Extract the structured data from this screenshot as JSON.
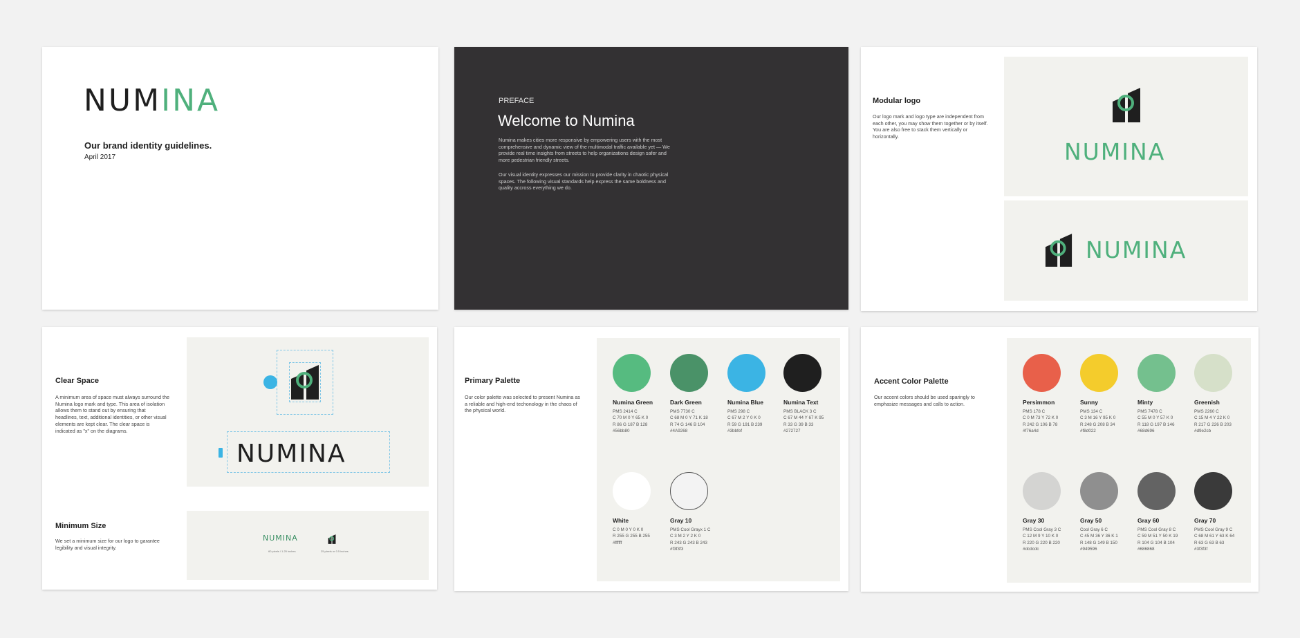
{
  "cover": {
    "logo_parts": [
      "NUM",
      "IN",
      "A"
    ],
    "title": "Our brand identity guidelines.",
    "date": "April 2017"
  },
  "preface": {
    "kicker": "PREFACE",
    "title": "Welcome to Numina",
    "para1": "Numina makes cities more responsive by empowering users with the most comprehensive and dynamic view of the multimodal traffic available yet — We provide real time insights from streets to help organizations design safer and more pedestrian friendly streets.",
    "para2": "Our visual identity expresses our mission to provide clarity in chaotic physical spaces. The following visual standards help express the same boldness and quality accross everything we do."
  },
  "modular": {
    "title": "Modular logo",
    "body": "Our logo mark and logo type are independent from each other, you may show them together or by itself. You are also free to stack them vertically or horizontally.",
    "wordmark": "NUMINA"
  },
  "clear_space": {
    "title": "Clear Space",
    "body": "A minimum area of space must always surround the Numina logo mark and type. This area of isolation allows them to stand out by ensuring that headlines, text, additional identities, or other visual elements are kept clear. The clear space is indicated as \"x\" on the diagrams.",
    "min_title": "Minimum Size",
    "min_body": "We set a minimum size for our logo to garantee legibility and visual integrity.",
    "wordmark": "NUMINA",
    "min_wordmark": "NUMINA",
    "min_label_1": "60 pixels / 1.25 inches",
    "min_label_2": "25 pixels or 0.5 inches"
  },
  "primary_palette": {
    "title": "Primary Palette",
    "body": "Our color palette was selected to present Numina as a reliable and high-end techonology in the chaos of the physical world.",
    "colors": [
      {
        "name": "Numina Green",
        "pms": "PMS 2414 C",
        "cmyk": "C 70 M 0 Y 65 K 0",
        "rgb": "R 86 G 187 B 128",
        "hex": "#56bb80",
        "color": "#56bb80"
      },
      {
        "name": "Dark Green",
        "pms": "PMS 7730 C",
        "cmyk": "C 68 M 0 Y 71 K 18",
        "rgb": "R 74 G 146 B 104",
        "hex": "#4A9268",
        "color": "#4a9268"
      },
      {
        "name": "Numina Blue",
        "pms": "PMS 298 C",
        "cmyk": "C 67 M 2 Y 0 K 0",
        "rgb": "R 59 G 191 B 239",
        "hex": "#3bbfef",
        "color": "#3bb4e4"
      },
      {
        "name": "Numina Text",
        "pms": "PMS BLACK 3 C",
        "cmyk": "C 67 M 44 Y 67 K 95",
        "rgb": "R 33 G 39 B 33",
        "hex": "#272727",
        "color": "#1f1f1f"
      },
      {
        "name": "White",
        "pms": "C 0 M 0 Y 0 K 0",
        "cmyk": "R 255 G 255 B 255",
        "rgb": "#ffffff",
        "hex": "",
        "color": "#ffffff"
      },
      {
        "name": "Gray 10",
        "pms": "PMS Cool Grayx 1 C",
        "cmyk": "C 3 M 2 Y 2 K 0",
        "rgb": "R 243 G 243 B 243",
        "hex": "#f3f3f3",
        "color": "#f3f3f3"
      }
    ]
  },
  "accent_palette": {
    "title": "Accent Color Palette",
    "body": "Our accent colors should be used sparingly to emphasize messages and calls to action.",
    "colors": [
      {
        "name": "Persimmon",
        "pms": "PMS 178 C",
        "cmyk": "C 0 M 73 Y 72 K 0",
        "rgb": "R 242 G 106 B 78",
        "hex": "#f76a4d",
        "color": "#e8604a"
      },
      {
        "name": "Sunny",
        "pms": "PMS 134 C",
        "cmyk": "C 3 M 16 Y 95 K 0",
        "rgb": "R 248 G 208 B 34",
        "hex": "#f8d022",
        "color": "#f4cc2c"
      },
      {
        "name": "Minty",
        "pms": "PMS 7478 C",
        "cmyk": "C 55 M 0 Y 57 K 0",
        "rgb": "R 118 G 197 B 146",
        "hex": "#68d696",
        "color": "#74c08e"
      },
      {
        "name": "Greenish",
        "pms": "PMS 2260 C",
        "cmyk": "C 15 M 4 Y 22 K 0",
        "rgb": "R 217 G 226 B 203",
        "hex": "#d9e2cb",
        "color": "#d6e0c9"
      },
      {
        "name": "Gray 30",
        "pms": "PMS Cool Gray 3 C",
        "cmyk": "C 12 M 9 Y 10 K 0",
        "rgb": "R 220 G 220 B 220",
        "hex": "#dcdcdc",
        "color": "#d4d4d2"
      },
      {
        "name": "Gray 50",
        "pms": "Cool Gray 6 C",
        "cmyk": "C 45 M 36 Y 36 K 1",
        "rgb": "R 148 G 149 B 150",
        "hex": "#949596",
        "color": "#8f8f8f"
      },
      {
        "name": "Gray 60",
        "pms": "PMS Cool Gray 8 C",
        "cmyk": "C 59 M 51 Y 50 K 19",
        "rgb": "R 104 G 104 B 104",
        "hex": "#686868",
        "color": "#636363"
      },
      {
        "name": "Gray 70",
        "pms": "PMS Cool Gray 9 C",
        "cmyk": "C 68 M 61 Y 63 K 64",
        "rgb": "R 63 G 63 B 63",
        "hex": "#3f3f3f",
        "color": "#3a3a3a"
      }
    ]
  },
  "brand_colors": {
    "green": "#4fb07c",
    "dark": "#1f1f1f",
    "blue": "#3bb4e4",
    "preface_bg": "#333133"
  }
}
